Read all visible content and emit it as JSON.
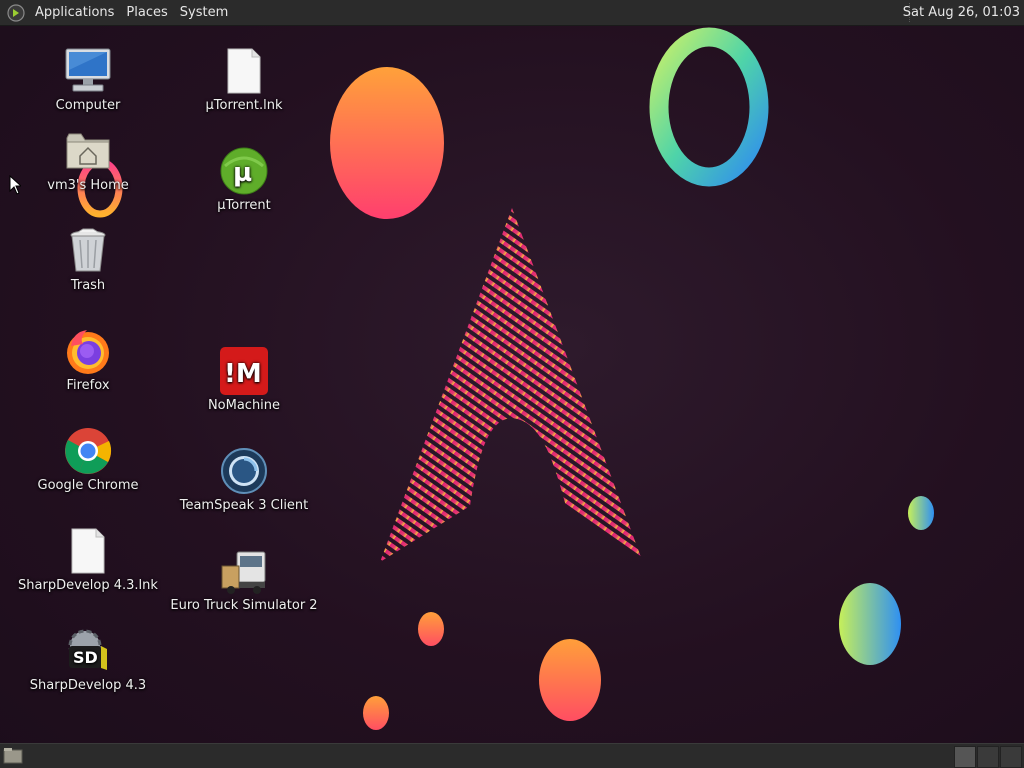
{
  "top_panel": {
    "menus": [
      "Applications",
      "Places",
      "System"
    ],
    "clock": "Sat Aug 26, 01:03"
  },
  "desktop_icons": [
    {
      "label": "Computer",
      "icon": "computer-icon"
    },
    {
      "label": "vm3's Home",
      "icon": "home-folder-icon"
    },
    {
      "label": "Trash",
      "icon": "trash-icon"
    },
    {
      "label": "Firefox",
      "icon": "firefox-icon"
    },
    {
      "label": "Google Chrome",
      "icon": "chrome-icon"
    },
    {
      "label": "SharpDevelop 4.3.lnk",
      "icon": "file-icon"
    },
    {
      "label": "SharpDevelop 4.3",
      "icon": "sharpdevelop-icon"
    },
    {
      "label": "μTorrent.lnk",
      "icon": "file-icon"
    },
    {
      "label": "μTorrent",
      "icon": "utorrent-icon"
    },
    {
      "label": "NoMachine",
      "icon": "nomachine-icon"
    },
    {
      "label": "TeamSpeak 3 Client",
      "icon": "teamspeak-icon"
    },
    {
      "label": "Euro Truck Simulator 2",
      "icon": "truck-icon"
    }
  ],
  "theme": {
    "panel_bg": "#2b2b2b",
    "desktop_bg": "#241322",
    "accent_pink": "#e8237a",
    "accent_orange": "#ff9a3c"
  }
}
